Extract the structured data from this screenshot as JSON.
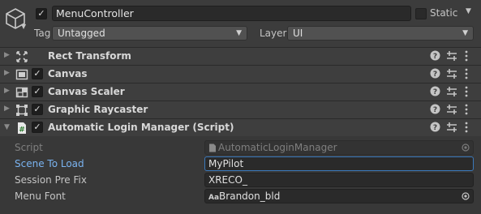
{
  "header": {
    "object_name": "MenuController",
    "active": true,
    "static_label": "Static",
    "static_checked": false,
    "tag_label": "Tag",
    "tag_value": "Untagged",
    "layer_label": "Layer",
    "layer_value": "UI"
  },
  "components": [
    {
      "title": "Rect Transform",
      "icon": "rect-transform-icon",
      "has_checkbox": false
    },
    {
      "title": "Canvas",
      "icon": "canvas-icon",
      "has_checkbox": true
    },
    {
      "title": "Canvas Scaler",
      "icon": "canvas-scaler-icon",
      "has_checkbox": true
    },
    {
      "title": "Graphic Raycaster",
      "icon": "graphic-raycaster-icon",
      "has_checkbox": true
    },
    {
      "title": "Automatic Login Manager (Script)",
      "icon": "script-icon",
      "has_checkbox": true
    }
  ],
  "script_properties": {
    "script_label": "Script",
    "script_value": "AutomaticLoginManager",
    "scene_label": "Scene To Load",
    "scene_value": "MyPilot",
    "prefix_label": "Session Pre Fix",
    "prefix_value": "XRECO_",
    "font_label": "Menu Font",
    "font_prefix": "Aa",
    "font_value": "Brandon_bld"
  },
  "colors": {
    "background": "#383838",
    "focused_label": "#7ab3f0",
    "focus_border": "#3a79bb"
  }
}
